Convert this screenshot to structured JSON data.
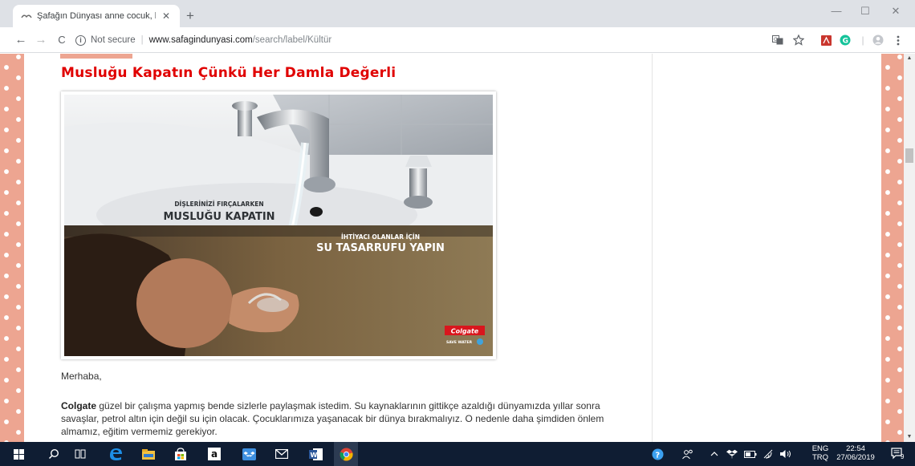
{
  "browser": {
    "tab_title": "Şafağın Dünyası anne cocuk, blo",
    "tab_close": "✕",
    "new_tab": "+",
    "window_controls": {
      "minimize": "—",
      "maximize": "☐",
      "close": "✕"
    },
    "nav": {
      "back": "←",
      "forward": "→",
      "reload": "C"
    },
    "info": "i",
    "security_label": "Not secure",
    "separator": "|",
    "url_domain": "www.safagindunyasi.com",
    "url_path": "/search/label/Kültür",
    "toolbar_icons": [
      "translate-icon",
      "star-icon",
      "pdf-extension-icon",
      "grammarly-icon",
      "profile-icon",
      "menu-icon"
    ]
  },
  "post": {
    "title": "Musluğu Kapatın Çünkü Her Damla Değerli",
    "image": {
      "line1_small": "DİŞLERİNİZİ FIRÇALARKEN",
      "line1_big": "MUSLUĞU KAPATIN",
      "line2_small": "İHTİYACI OLANLAR İÇİN",
      "line2_big": "SU TASARRUFU YAPIN",
      "brand": "Colgate",
      "brand_sub": "SAVE WATER"
    },
    "greeting": "Merhaba,",
    "body_bold": "Colgate",
    "body_text": " güzel bir çalışma yapmış bende sizlerle paylaşmak istedim. Su kaynaklarının gittikçe azaldığı dünyamızda yıllar sonra savaşlar, petrol altın için değil su için olacak. Çocuklarımıza yaşanacak bir dünya bırakmalıyız. O nedenle daha şimdiden önlem almamız, eğitim vermemiz gerekiyor."
  },
  "taskbar": {
    "apps": [
      "windows-start-icon",
      "search-icon",
      "task-view-icon",
      "edge-icon",
      "file-explorer-icon",
      "store-icon",
      "amazon-icon",
      "dropbox-icon",
      "mail-icon",
      "word-icon",
      "chrome-icon"
    ],
    "language_top": "ENG",
    "language_bottom": "TRQ",
    "time": "22:54",
    "date": "27/06/2019",
    "notification_count": "9"
  },
  "colors": {
    "accent_red": "#e00000",
    "border_salmon": "#eda591",
    "taskbar": "#0f1d33"
  }
}
